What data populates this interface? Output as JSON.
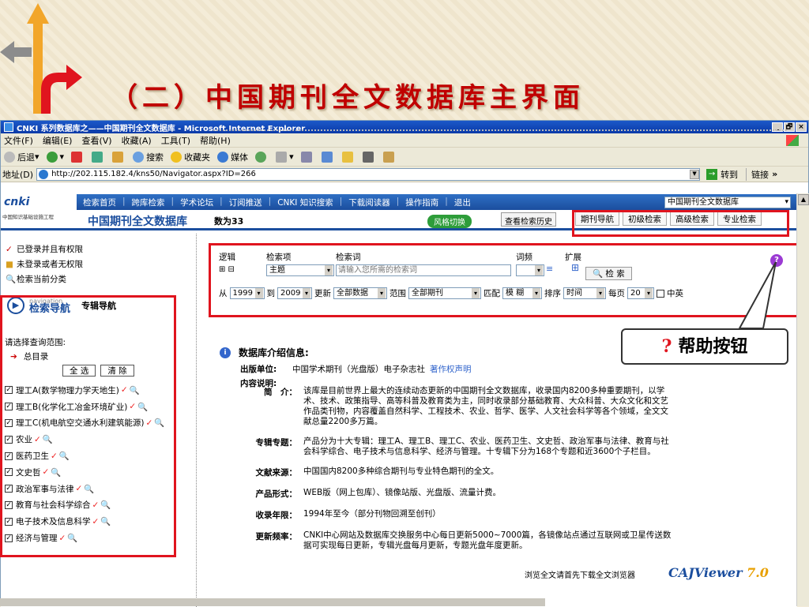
{
  "slide": {
    "title": "（二）中国期刊全文数据库主界面"
  },
  "window": {
    "title": "CNKI 系列数据库之——中国期刊全文数据库 - Microsoft Internet Explorer",
    "controls": [
      "_",
      "🗗",
      "×"
    ],
    "menu": [
      "文件(F)",
      "编辑(E)",
      "查看(V)",
      "收藏(A)",
      "工具(T)",
      "帮助(H)"
    ],
    "toolbar": {
      "back": "后退",
      "search": "搜索",
      "favorites": "收藏夹",
      "media": "媒体"
    },
    "address": {
      "label": "地址(D)",
      "url": "http://202.115.182.4/kns50/Navigator.aspx?ID=266",
      "go": "转到",
      "links": "链接"
    }
  },
  "site": {
    "logo": "cnki",
    "logo_sub": "中国知识基础设施工程",
    "system_name": "中国期刊全文数据库",
    "top_links": [
      "检索首页",
      "跨库检索",
      "学术论坛",
      "订阅推送",
      "CNKI 知识搜索",
      "下载阅读器",
      "操作指南",
      "退出"
    ],
    "db_select": "中国期刊全文数据库",
    "count_text": "数为33",
    "style_switch": "风格切换",
    "history": "查看检索历史",
    "nav_tabs": [
      "期刊导航",
      "初级检索",
      "高级检索",
      "专业检索"
    ]
  },
  "sidebar": {
    "status": [
      "已登录并且有权限",
      "未登录或者无权限",
      "检索当前分类"
    ],
    "nav_en": "navigation",
    "nav_cn": "检索导航",
    "nav_sub": "专辑导航",
    "scope_label": "请选择查询范围:",
    "all_label": "总目录",
    "select_all": "全 选",
    "clear": "清 除",
    "categories": [
      "理工A(数学物理力学天地生)",
      "理工B(化学化工冶金环境矿业)",
      "理工C(机电航空交通水利建筑能源)",
      "农业",
      "医药卫生",
      "文史哲",
      "政治军事与法律",
      "教育与社会科学综合",
      "电子技术及信息科学",
      "经济与管理"
    ]
  },
  "search": {
    "headers": {
      "logic": "逻辑",
      "field": "检索项",
      "term": "检索词",
      "freq": "词频",
      "expand": "扩展"
    },
    "field_value": "主题",
    "term_placeholder": "请输入您所需的检索词",
    "search_button": "检 索",
    "from_label": "从",
    "from_year": "1999",
    "to_label": "到",
    "to_year": "2009",
    "update_label": "更新",
    "update_value": "全部数据",
    "range_label": "范围",
    "range_value": "全部期刊",
    "match_label": "匹配",
    "match_value": "模 糊",
    "sort_label": "排序",
    "sort_value": "时间",
    "perpage_label": "每页",
    "perpage_value": "20",
    "bilingual_label": "中英"
  },
  "info": {
    "title": "数据库介绍信息:",
    "publisher_label": "出版单位:",
    "publisher": "中国学术期刊（光盘版）电子杂志社",
    "copyright": "著作权声明",
    "content_label": "内容说明:",
    "details": [
      {
        "k": "简　介：",
        "v": "该库是目前世界上最大的连续动态更新的中国期刊全文数据库，收录国内8200多种重要期刊，以学术、技术、政策指导、高等科普及教育类为主，同时收录部分基础教育、大众科普、大众文化和文艺作品类刊物，内容覆盖自然科学、工程技术、农业、哲学、医学、人文社会科学等各个领域，全文文献总量2200多万篇。"
      },
      {
        "k": "专辑专题：",
        "v": "产品分为十大专辑：理工A、理工B、理工C、农业、医药卫生、文史哲、政治军事与法律、教育与社会科学综合、电子技术与信息科学、经济与管理。十专辑下分为168个专题和近3600个子栏目。"
      },
      {
        "k": "文献来源：",
        "v": "中国国内8200多种综合期刊与专业特色期刊的全文。"
      },
      {
        "k": "产品形式：",
        "v": "WEB版（网上包库）、镜像站版、光盘版、流量计费。"
      },
      {
        "k": "收录年限：",
        "v": "1994年至今（部分刊物回溯至创刊）"
      },
      {
        "k": "更新频率：",
        "v": "CNKI中心网站及数据库交换服务中心每日更新5000~7000篇，各镜像站点通过互联网或卫星传送数据可实现每日更新，专辑光盘每月更新，专题光盘年度更新。"
      }
    ],
    "viewer_text": "浏览全文请首先下载全文浏览器",
    "viewer_logo": "CAJViewer",
    "viewer_version": "7.0"
  },
  "callout": {
    "q": "?",
    "text": "帮助按钮"
  },
  "colors": {
    "title_red": "#c00000",
    "highlight": "#e0141e",
    "cnki_blue": "#1b4e9e"
  }
}
